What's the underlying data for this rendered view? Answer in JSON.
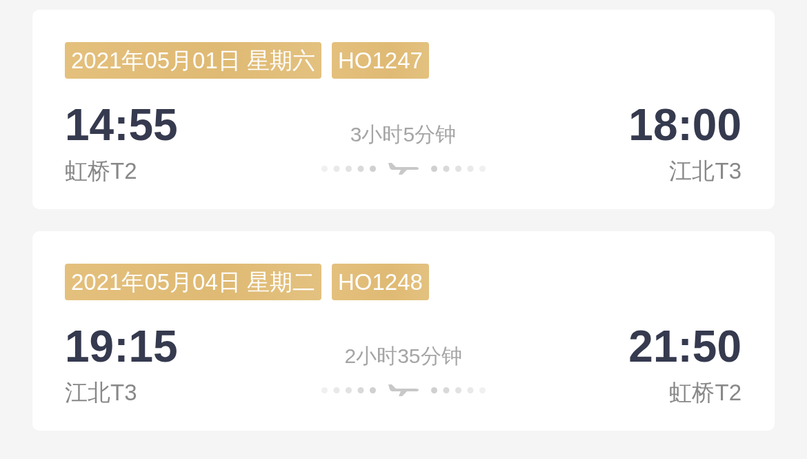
{
  "flights": [
    {
      "date": "2021年05月01日 星期六",
      "flight_no": "HO1247",
      "departure": {
        "time": "14:55",
        "airport": "虹桥T2"
      },
      "duration": "3小时5分钟",
      "arrival": {
        "time": "18:00",
        "airport": "江北T3"
      }
    },
    {
      "date": "2021年05月04日 星期二",
      "flight_no": "HO1248",
      "departure": {
        "time": "19:15",
        "airport": "江北T3"
      },
      "duration": "2小时35分钟",
      "arrival": {
        "time": "21:50",
        "airport": "虹桥T2"
      }
    }
  ]
}
